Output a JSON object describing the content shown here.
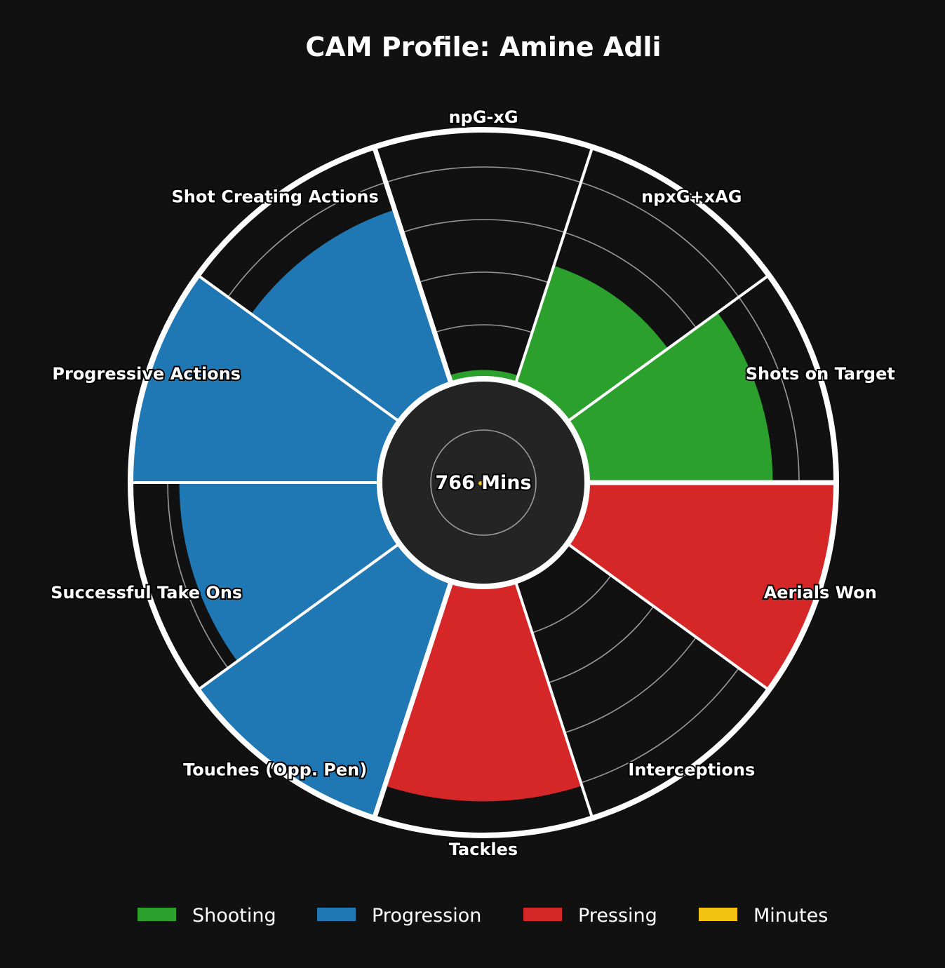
{
  "chart_data": {
    "type": "bar",
    "subtype": "polar-pizza",
    "title": "CAM Profile: Amine Adli",
    "center_label": "766 Mins",
    "rlim": [
      0,
      100
    ],
    "grid": true,
    "legend_placement": "bottom",
    "categories": [
      "npG-xG",
      "npxG+xAG",
      "Shots on Target",
      "Aerials Won",
      "Interceptions",
      "Tackles",
      "Touches (Opp. Pen)",
      "Successful Take Ons",
      "Progressive Actions",
      "Shot Creating Actions"
    ],
    "values": [
      3,
      50,
      75,
      100,
      0,
      87,
      100,
      81,
      100,
      74
    ],
    "groups": [
      "Shooting",
      "Shooting",
      "Shooting",
      "Pressing",
      "Pressing",
      "Pressing",
      "Progression",
      "Progression",
      "Progression",
      "Progression"
    ],
    "legend": [
      {
        "name": "Shooting",
        "color": "#2ca02c"
      },
      {
        "name": "Progression",
        "color": "#1f77b4"
      },
      {
        "name": "Pressing",
        "color": "#d62728"
      },
      {
        "name": "Minutes",
        "color": "#f1c40f"
      }
    ]
  },
  "colors": {
    "background": "#111111",
    "center_disc": "#242424",
    "divider": "#ffffff",
    "gridline": "#9a9a9a"
  }
}
